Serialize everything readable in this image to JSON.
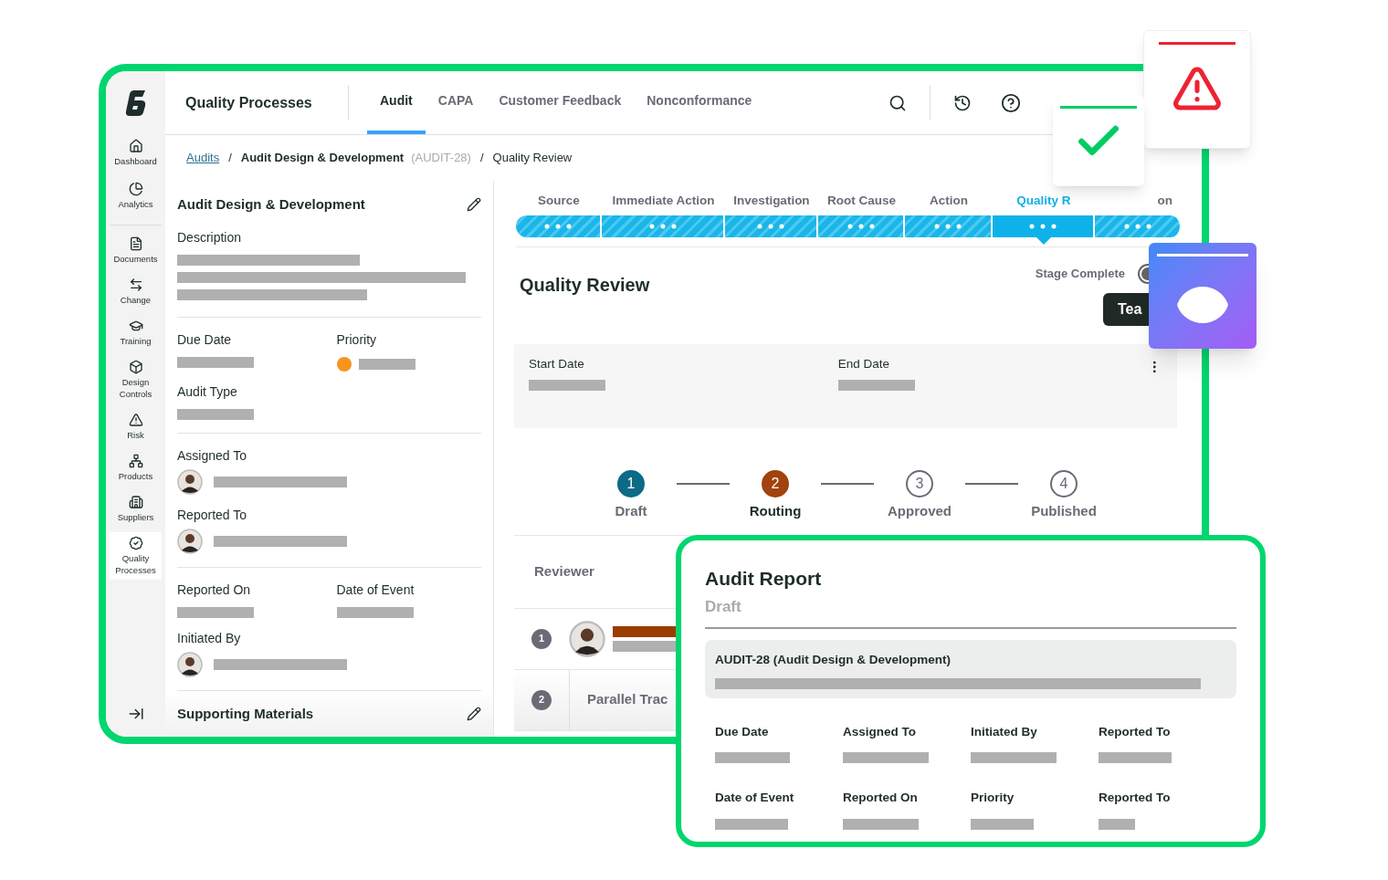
{
  "app": {
    "title": "Quality Processes"
  },
  "tabs": [
    {
      "label": "Audit",
      "selected": true
    },
    {
      "label": "CAPA",
      "selected": false
    },
    {
      "label": "Customer Feedback",
      "selected": false
    },
    {
      "label": "Nonconformance",
      "selected": false
    }
  ],
  "sidebar": {
    "groups": [
      [
        {
          "label": "Dashboard",
          "selected": false
        },
        {
          "label": "Analytics",
          "selected": false
        }
      ],
      [
        {
          "label": "Documents",
          "selected": false
        },
        {
          "label": "Change",
          "selected": false
        },
        {
          "label": "Training",
          "selected": false
        },
        {
          "label": "Design Controls",
          "selected": false
        },
        {
          "label": "Risk",
          "selected": false
        },
        {
          "label": "Products",
          "selected": false
        },
        {
          "label": "Suppliers",
          "selected": false
        },
        {
          "label": "Quality Processes",
          "selected": true
        }
      ]
    ]
  },
  "breadcrumb": {
    "separator": "/",
    "items": [
      {
        "label": "Audits",
        "kind": "link"
      },
      {
        "label": "Audit Design & Development",
        "note": "(AUDIT-28)",
        "kind": "record"
      },
      {
        "label": "Quality Review",
        "kind": "plain"
      }
    ]
  },
  "details": {
    "title": "Audit Design & Development",
    "description_label": "Description",
    "sections": [
      [
        {
          "label": "Due Date",
          "kind": "text"
        },
        {
          "label": "Priority",
          "kind": "priority",
          "color": "#f7941d"
        },
        {
          "label": "Audit Type",
          "kind": "text"
        }
      ],
      [
        {
          "label": "Assigned To",
          "kind": "person"
        },
        {
          "label": "Reported To",
          "kind": "person"
        }
      ],
      [
        {
          "label": "Reported On",
          "kind": "text"
        },
        {
          "label": "Date of Event",
          "kind": "text"
        },
        {
          "label": "Initiated By",
          "kind": "person"
        }
      ]
    ],
    "footer": "Supporting Materials"
  },
  "stages": [
    {
      "label": "Source",
      "selected": false
    },
    {
      "label": "Immediate Action",
      "selected": false
    },
    {
      "label": "Investigation",
      "selected": false
    },
    {
      "label": "Root Cause",
      "selected": false
    },
    {
      "label": "Action",
      "selected": false
    },
    {
      "label": "Quality R",
      "selected": true
    },
    {
      "label": "on",
      "selected": false
    }
  ],
  "review": {
    "title": "Quality Review",
    "stage_complete": {
      "label": "Stage Complete",
      "on": false
    },
    "button": "Tea",
    "dates": [
      {
        "label": "Start Date"
      },
      {
        "label": "End Date"
      }
    ],
    "steps": [
      {
        "number": "1",
        "label": "Draft",
        "kind": "done"
      },
      {
        "number": "2",
        "label": "Routing",
        "kind": "current"
      },
      {
        "number": "3",
        "label": "Approved",
        "kind": "pending"
      },
      {
        "number": "4",
        "label": "Published",
        "kind": "pending"
      }
    ],
    "reviewer_header": "Reviewer",
    "rows": [
      {
        "number": "1",
        "kind": "person"
      },
      {
        "number": "2",
        "kind": "parallel",
        "label": "Parallel Trac"
      }
    ]
  },
  "report": {
    "title": "Audit Report",
    "status": "Draft",
    "record": "AUDIT-28 (Audit Design & Development)",
    "fields": [
      {
        "label": "Due Date"
      },
      {
        "label": "Assigned To"
      },
      {
        "label": "Initiated By"
      },
      {
        "label": "Reported To"
      },
      {
        "label": "Date of Event"
      },
      {
        "label": "Reported On"
      },
      {
        "label": "Priority"
      },
      {
        "label": "Reported To"
      }
    ]
  }
}
